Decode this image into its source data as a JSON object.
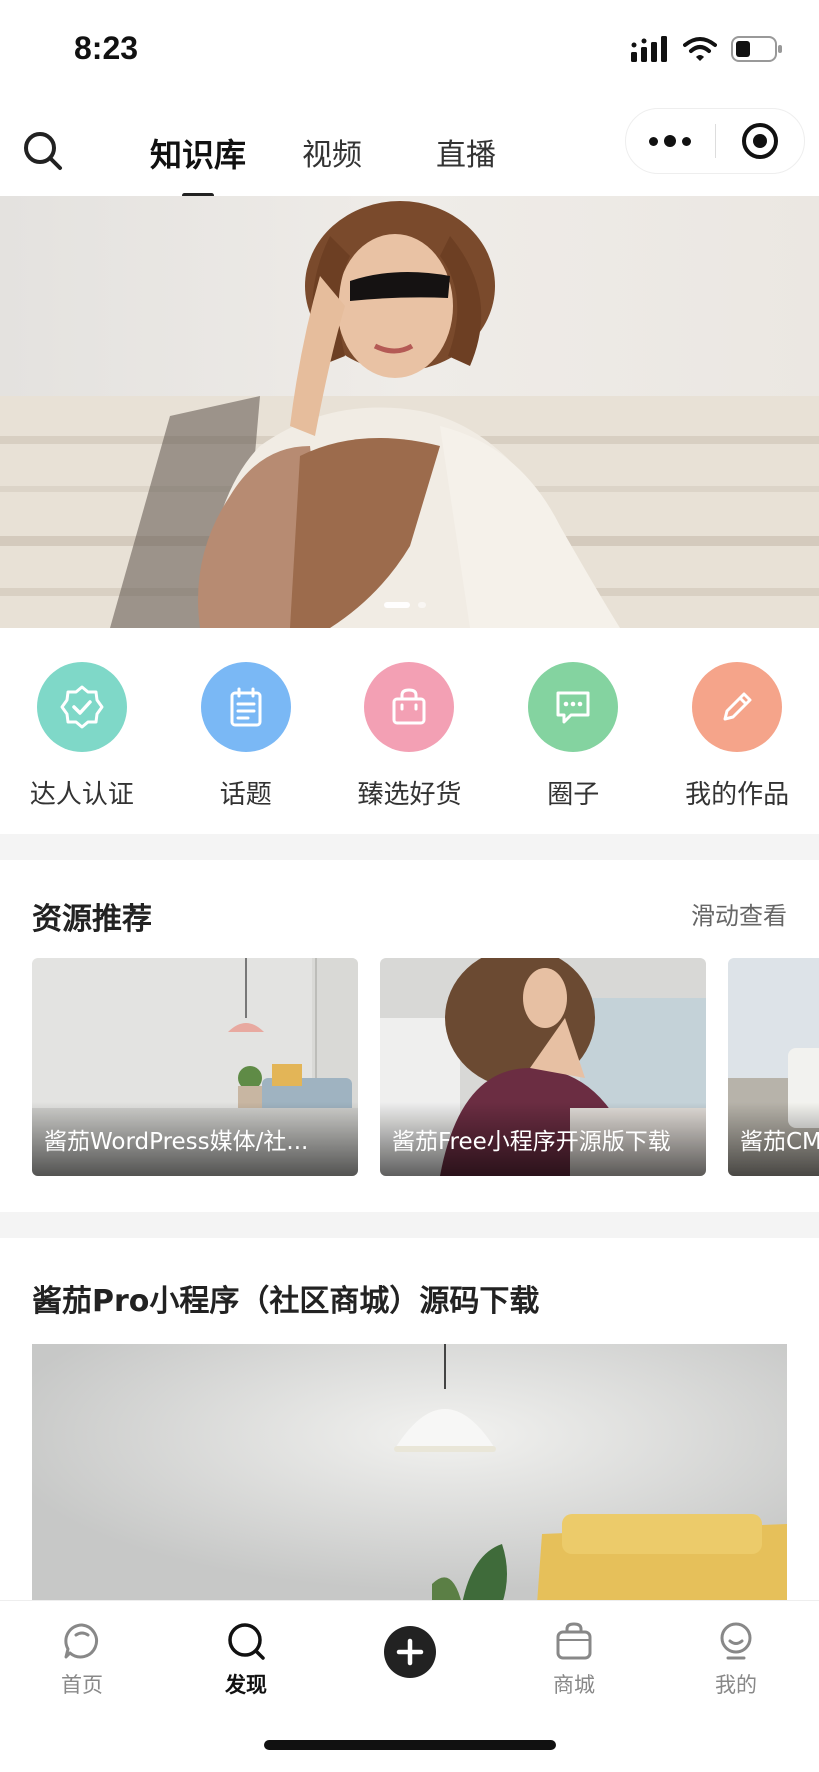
{
  "status_bar": {
    "time": "8:23"
  },
  "top_nav": {
    "tabs": [
      {
        "label": "知识库",
        "active": true
      },
      {
        "label": "视频",
        "active": false
      },
      {
        "label": "直播",
        "active": false
      }
    ],
    "icons": {
      "search": "search-icon",
      "more": "more-dots-icon",
      "close": "target-icon"
    }
  },
  "banner": {
    "slides": 2,
    "active_slide": 1
  },
  "quick_actions": [
    {
      "label": "达人认证",
      "icon": "badge-check-icon",
      "color": "#7fd8c8"
    },
    {
      "label": "话题",
      "icon": "notepad-icon",
      "color": "#7ab8f5"
    },
    {
      "label": "臻选好货",
      "icon": "shopping-bag-icon",
      "color": "#f3a0b4"
    },
    {
      "label": "圈子",
      "icon": "chat-bubble-icon",
      "color": "#84d3a0"
    },
    {
      "label": "我的作品",
      "icon": "pencil-icon",
      "color": "#f5a48a"
    }
  ],
  "resources": {
    "title": "资源推荐",
    "more": "滑动查看",
    "cards": [
      {
        "caption": "酱茄WordPress媒体/社..."
      },
      {
        "caption": "酱茄Free小程序开源版下载"
      },
      {
        "caption": "酱茄CMS"
      }
    ]
  },
  "article": {
    "title": "酱茄Pro小程序（社区商城）源码下载"
  },
  "tabbar": {
    "items": [
      {
        "label": "首页",
        "icon": "chat-circle-icon",
        "active": false
      },
      {
        "label": "发现",
        "icon": "search-icon",
        "active": true
      },
      {
        "label": "",
        "icon": "plus-circle-icon",
        "active": false
      },
      {
        "label": "商城",
        "icon": "bag-icon",
        "active": false
      },
      {
        "label": "我的",
        "icon": "user-icon",
        "active": false
      }
    ]
  },
  "colors": {
    "accent": "#222222",
    "inactive": "#888888",
    "band": "#f4f4f4"
  }
}
